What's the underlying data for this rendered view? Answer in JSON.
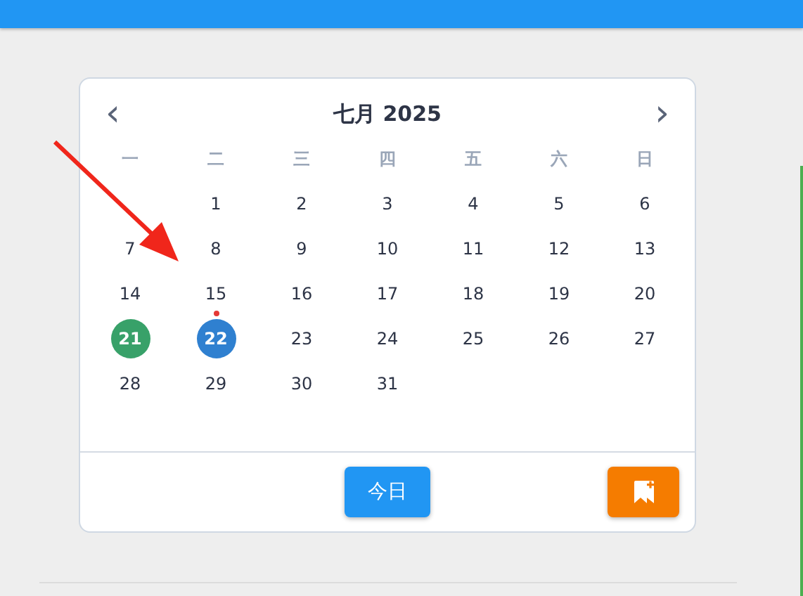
{
  "calendar": {
    "month_title": "七月 2025",
    "prev": "‹",
    "next": "›",
    "weekdays": [
      "一",
      "二",
      "三",
      "四",
      "五",
      "六",
      "日"
    ],
    "weeks": [
      [
        {
          "kind": "blank"
        },
        {
          "kind": "day",
          "day": "1",
          "selected": false,
          "today": false,
          "event": false
        },
        {
          "kind": "day",
          "day": "2",
          "selected": false,
          "today": false,
          "event": false
        },
        {
          "kind": "day",
          "day": "3",
          "selected": false,
          "today": false,
          "event": false
        },
        {
          "kind": "day",
          "day": "4",
          "selected": false,
          "today": false,
          "event": false
        },
        {
          "kind": "day",
          "day": "5",
          "selected": false,
          "today": false,
          "event": false
        },
        {
          "kind": "day",
          "day": "6",
          "selected": false,
          "today": false,
          "event": false
        }
      ],
      [
        {
          "kind": "day",
          "day": "7",
          "selected": false,
          "today": false,
          "event": false
        },
        {
          "kind": "day",
          "day": "8",
          "selected": false,
          "today": false,
          "event": false
        },
        {
          "kind": "day",
          "day": "9",
          "selected": false,
          "today": false,
          "event": false
        },
        {
          "kind": "day",
          "day": "10",
          "selected": false,
          "today": false,
          "event": false
        },
        {
          "kind": "day",
          "day": "11",
          "selected": false,
          "today": false,
          "event": false
        },
        {
          "kind": "day",
          "day": "12",
          "selected": false,
          "today": false,
          "event": false
        },
        {
          "kind": "day",
          "day": "13",
          "selected": false,
          "today": false,
          "event": false
        }
      ],
      [
        {
          "kind": "day",
          "day": "14",
          "selected": false,
          "today": false,
          "event": false
        },
        {
          "kind": "day",
          "day": "15",
          "selected": false,
          "today": false,
          "event": true
        },
        {
          "kind": "day",
          "day": "16",
          "selected": false,
          "today": false,
          "event": false
        },
        {
          "kind": "day",
          "day": "17",
          "selected": false,
          "today": false,
          "event": false
        },
        {
          "kind": "day",
          "day": "18",
          "selected": false,
          "today": false,
          "event": false
        },
        {
          "kind": "day",
          "day": "19",
          "selected": false,
          "today": false,
          "event": false
        },
        {
          "kind": "day",
          "day": "20",
          "selected": false,
          "today": false,
          "event": false
        }
      ],
      [
        {
          "kind": "day",
          "day": "21",
          "selected": false,
          "today": true,
          "event": false
        },
        {
          "kind": "day",
          "day": "22",
          "selected": true,
          "today": false,
          "event": false
        },
        {
          "kind": "day",
          "day": "23",
          "selected": false,
          "today": false,
          "event": false
        },
        {
          "kind": "day",
          "day": "24",
          "selected": false,
          "today": false,
          "event": false
        },
        {
          "kind": "day",
          "day": "25",
          "selected": false,
          "today": false,
          "event": false
        },
        {
          "kind": "day",
          "day": "26",
          "selected": false,
          "today": false,
          "event": false
        },
        {
          "kind": "day",
          "day": "27",
          "selected": false,
          "today": false,
          "event": false
        }
      ],
      [
        {
          "kind": "day",
          "day": "28",
          "selected": false,
          "today": false,
          "event": false
        },
        {
          "kind": "day",
          "day": "29",
          "selected": false,
          "today": false,
          "event": false
        },
        {
          "kind": "day",
          "day": "30",
          "selected": false,
          "today": false,
          "event": false
        },
        {
          "kind": "day",
          "day": "31",
          "selected": false,
          "today": false,
          "event": false
        },
        {
          "kind": "blank"
        },
        {
          "kind": "blank"
        },
        {
          "kind": "blank"
        }
      ]
    ],
    "today_button": "今日"
  }
}
